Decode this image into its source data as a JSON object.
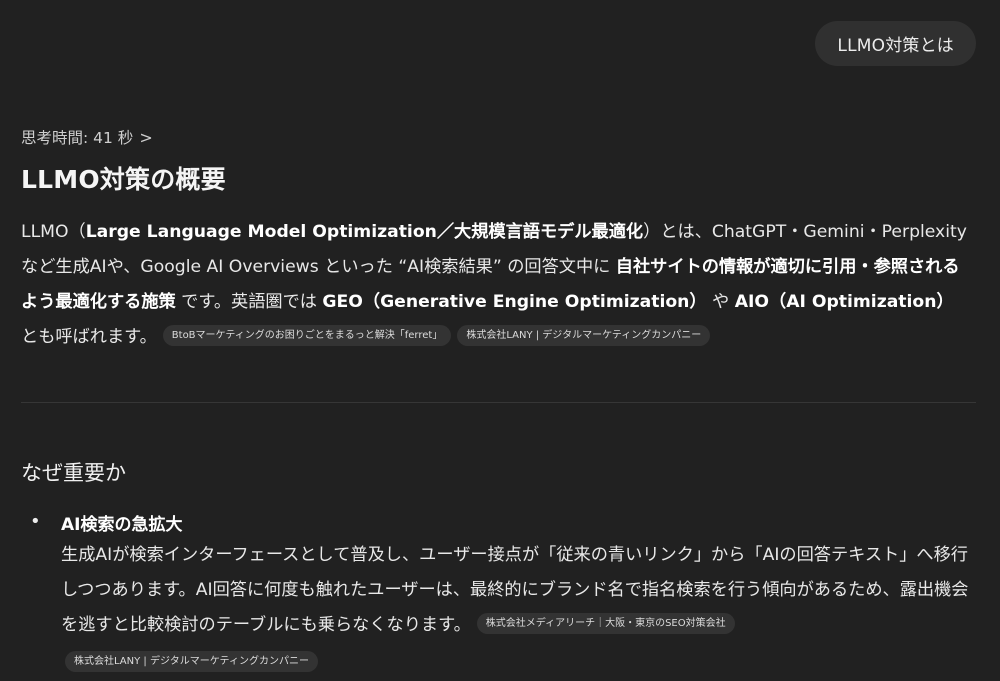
{
  "user_message": {
    "text": "LLMO対策とは"
  },
  "thinking": {
    "label": "思考時間: 41 秒",
    "chevron": ">"
  },
  "answer": {
    "title": "LLMO対策の概要",
    "intro": {
      "p1": "LLMO（",
      "b1": "Large Language Model Optimization／大規模言語モデル最適化",
      "p2": "）とは、ChatGPT・Gemini・Perplexity など生成AIや、Google AI Overviews といった “AI検索結果” の回答文中に ",
      "b2": "自社サイトの情報が適切に引用・参照されるよう最適化する施策",
      "p3": " です。英語圏では ",
      "b3": "GEO（Generative Engine Optimization）",
      "p4": " や ",
      "b4": "AIO（AI Optimization）",
      "p5": " とも呼ばれます。",
      "sources": [
        "BtoBマーケティングのお困りごとをまるっと解決「ferret」",
        "株式会社LANY | デジタルマーケティングカンパニー"
      ]
    },
    "section_heading": "なぜ重要か",
    "bullet": {
      "heading": "AI検索の急拡大",
      "body": "生成AIが検索インターフェースとして普及し、ユーザー接点が「従来の青いリンク」から「AIの回答テキスト」へ移行しつつあります。AI回答に何度も触れたユーザーは、最終的にブランド名で指名検索を行う傾向があるため、露出機会を逃すと比較検討のテーブルにも乗らなくなります。",
      "sources": [
        "株式会社メディアリーチ｜大阪・東京のSEO対策会社",
        "株式会社LANY | デジタルマーケティングカンパニー"
      ]
    }
  }
}
